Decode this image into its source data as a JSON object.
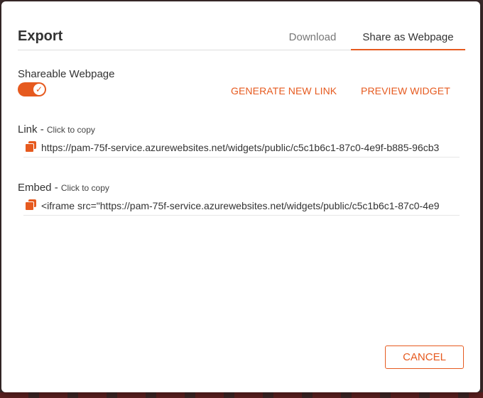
{
  "dialog": {
    "title": "Export",
    "tabs": [
      {
        "label": "Download",
        "active": false
      },
      {
        "label": "Share as Webpage",
        "active": true
      }
    ]
  },
  "shareable": {
    "label": "Shareable Webpage",
    "enabled": true,
    "check_glyph": "✓"
  },
  "actions": {
    "generate": "GENERATE NEW LINK",
    "preview": "PREVIEW WIDGET"
  },
  "link": {
    "label": "Link",
    "separator": " - ",
    "hint": "Click to copy",
    "value": "https://pam-75f-service.azurewebsites.net/widgets/public/c5c1b6c1-87c0-4e9f-b885-96cb3"
  },
  "embed": {
    "label": "Embed",
    "separator": " - ",
    "hint": "Click to copy",
    "value": "<iframe src=\"https://pam-75f-service.azurewebsites.net/widgets/public/c5c1b6c1-87c0-4e9"
  },
  "footer": {
    "cancel": "CANCEL"
  },
  "colors": {
    "accent": "#e65a1f"
  },
  "icons": {
    "copy": "copy-icon",
    "check": "check-icon"
  }
}
